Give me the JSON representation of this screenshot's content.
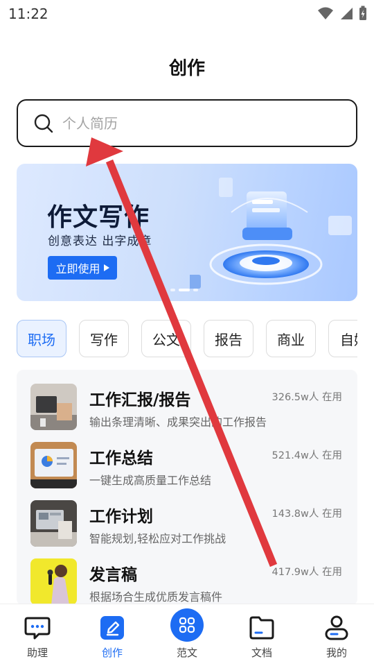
{
  "status_bar": {
    "time": "11:22"
  },
  "page": {
    "title": "创作"
  },
  "search": {
    "placeholder": "个人简历"
  },
  "banner": {
    "title": "作文写作",
    "subtitle": "创意表达 出字成章",
    "cta_label": "立即使用"
  },
  "categories": [
    "职场",
    "写作",
    "公文",
    "报告",
    "商业",
    "自媒体"
  ],
  "active_category": "职场",
  "items": [
    {
      "title": "工作汇报/报告",
      "desc": "输出条理清晰、成果突出的工作报告",
      "users": "326.5w人 在用"
    },
    {
      "title": "工作总结",
      "desc": "一键生成高质量工作总结",
      "users": "521.4w人 在用"
    },
    {
      "title": "工作计划",
      "desc": "智能规划,轻松应对工作挑战",
      "users": "143.8w人 在用"
    },
    {
      "title": "发言稿",
      "desc": "根据场合生成优质发言稿件",
      "users": "417.9w人 在用"
    }
  ],
  "nav": [
    {
      "label": "助理",
      "icon": "chat-bubble-icon"
    },
    {
      "label": "创作",
      "icon": "edit-pen-icon"
    },
    {
      "label": "范文",
      "icon": "grid-apps-icon"
    },
    {
      "label": "文档",
      "icon": "folder-icon"
    },
    {
      "label": "我的",
      "icon": "user-icon"
    }
  ],
  "active_nav": "创作",
  "colors": {
    "accent": "#1d6cf3",
    "annotation": "#e0393e"
  }
}
